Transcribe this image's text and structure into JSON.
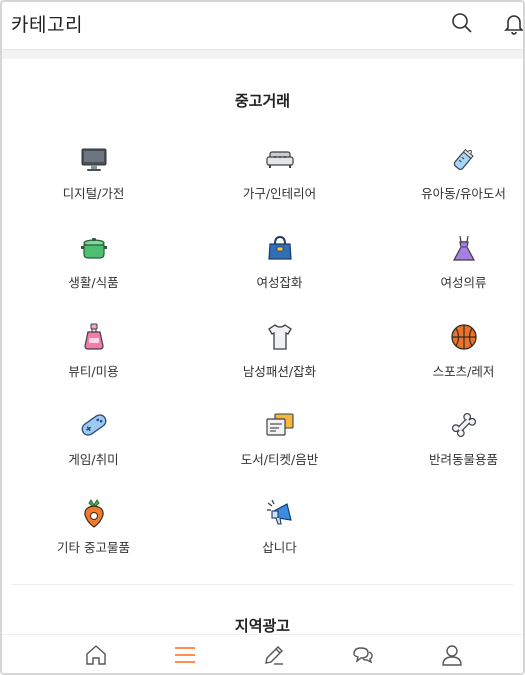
{
  "header": {
    "title": "카테고리",
    "search_icon": "search-icon",
    "bell_icon": "bell-icon"
  },
  "sections": {
    "used_trade": {
      "title": "중고거래",
      "items": [
        {
          "label": "디지털/가전",
          "icon": "monitor-icon"
        },
        {
          "label": "가구/인테리어",
          "icon": "sofa-icon"
        },
        {
          "label": "유아동/유아도서",
          "icon": "baby-bottle-icon"
        },
        {
          "label": "생활/식품",
          "icon": "pot-icon"
        },
        {
          "label": "여성잡화",
          "icon": "handbag-icon"
        },
        {
          "label": "여성의류",
          "icon": "dress-icon"
        },
        {
          "label": "뷰티/미용",
          "icon": "perfume-icon"
        },
        {
          "label": "남성패션/잡화",
          "icon": "tshirt-icon"
        },
        {
          "label": "스포츠/레저",
          "icon": "basketball-icon"
        },
        {
          "label": "게임/취미",
          "icon": "gamepad-icon"
        },
        {
          "label": "도서/티켓/음반",
          "icon": "tickets-icon"
        },
        {
          "label": "반려동물용품",
          "icon": "bone-icon"
        },
        {
          "label": "기타 중고물품",
          "icon": "carrot-icon"
        },
        {
          "label": "삽니다",
          "icon": "megaphone-icon"
        }
      ]
    },
    "local_ads": {
      "title": "지역광고"
    }
  },
  "tabbar": {
    "accent_color": "#ff7e36",
    "items": [
      {
        "icon": "home-icon",
        "label": ""
      },
      {
        "icon": "menu-icon",
        "label": ""
      },
      {
        "icon": "pencil-icon",
        "label": ""
      },
      {
        "icon": "chat-icon",
        "label": ""
      },
      {
        "icon": "person-icon",
        "label": ""
      }
    ]
  }
}
